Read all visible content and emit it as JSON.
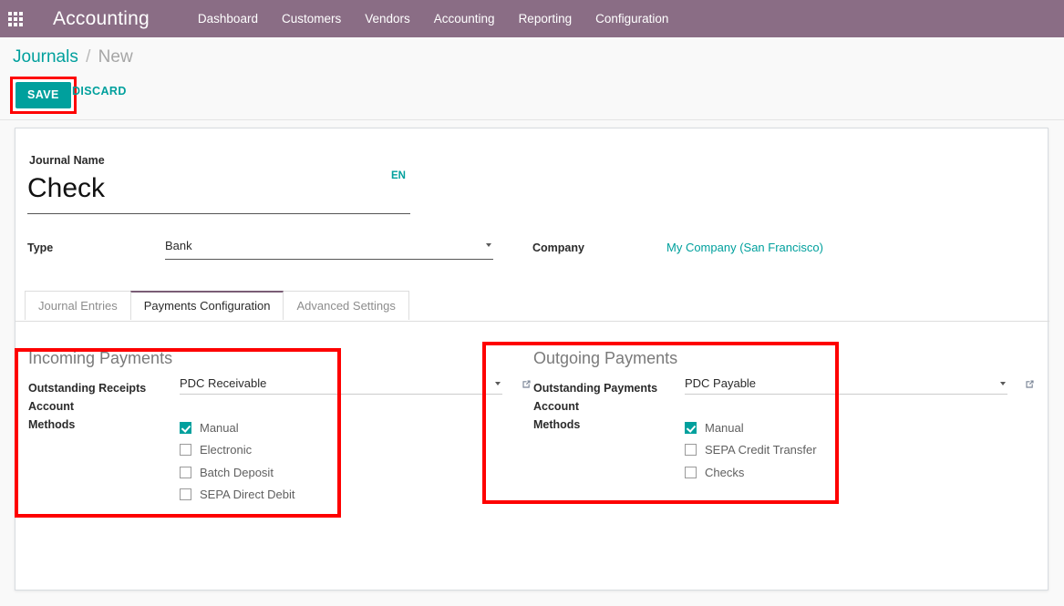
{
  "navbar": {
    "apps_icon": "apps-grid-icon",
    "brand": "Accounting",
    "menu": [
      {
        "label": "Dashboard"
      },
      {
        "label": "Customers"
      },
      {
        "label": "Vendors"
      },
      {
        "label": "Accounting"
      },
      {
        "label": "Reporting"
      },
      {
        "label": "Configuration"
      }
    ]
  },
  "breadcrumb": {
    "parent": "Journals",
    "separator": "/",
    "current": "New"
  },
  "actions": {
    "save_label": "SAVE",
    "discard_label": "DISCARD"
  },
  "form": {
    "journal_name_label": "Journal Name",
    "journal_name_value": "Check",
    "language_badge": "EN",
    "type_label": "Type",
    "type_value": "Bank",
    "company_label": "Company",
    "company_value": "My Company (San Francisco)"
  },
  "tabs": [
    {
      "label": "Journal Entries",
      "active": false
    },
    {
      "label": "Payments Configuration",
      "active": true
    },
    {
      "label": "Advanced Settings",
      "active": false
    }
  ],
  "incoming": {
    "title": "Incoming Payments",
    "account_label": "Outstanding Receipts Account",
    "account_value": "PDC Receivable",
    "methods_label": "Methods",
    "methods": [
      {
        "label": "Manual",
        "checked": true
      },
      {
        "label": "Electronic",
        "checked": false
      },
      {
        "label": "Batch Deposit",
        "checked": false
      },
      {
        "label": "SEPA Direct Debit",
        "checked": false
      }
    ]
  },
  "outgoing": {
    "title": "Outgoing Payments",
    "account_label": "Outstanding Payments Account",
    "account_value": "PDC Payable",
    "methods_label": "Methods",
    "methods": [
      {
        "label": "Manual",
        "checked": true
      },
      {
        "label": "SEPA Credit Transfer",
        "checked": false
      },
      {
        "label": "Checks",
        "checked": false
      }
    ]
  },
  "colors": {
    "navbar": "#8a6d85",
    "accent": "#00a09d",
    "annotation": "#fe0000"
  }
}
